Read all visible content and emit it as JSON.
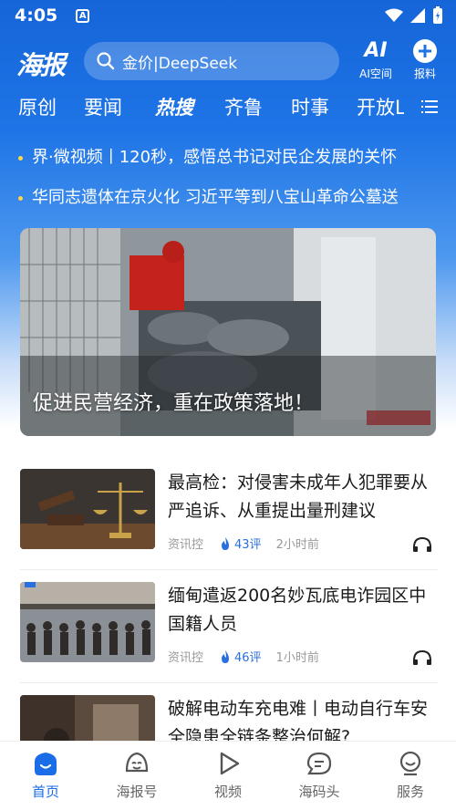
{
  "status": {
    "time": "4:05",
    "a_badge": "A"
  },
  "header": {
    "logo": "海报",
    "search_text": "金价|DeepSeek",
    "ai_label": "AI空间",
    "report_label": "报料",
    "ai_glyph": "AI"
  },
  "tabs": [
    "原创",
    "要闻",
    "热搜",
    "齐鲁",
    "时事",
    "开放L"
  ],
  "ticker": [
    "界·微视频丨120秒，感悟总书记对民企发展的关怀",
    "华同志遗体在京火化 习近平等到八宝山革命公墓送"
  ],
  "hero": {
    "caption": "促进民营经济，重在政策落地！"
  },
  "news": [
    {
      "title": "最高检：对侵害未成年人犯罪要从严追诉、从重提出量刑建议",
      "source": "资讯控",
      "comments": "43评",
      "time": "2小时前"
    },
    {
      "title": "缅甸遣返200名妙瓦底电诈园区中国籍人员",
      "source": "资讯控",
      "comments": "46评",
      "time": "1小时前"
    },
    {
      "title": "破解电动车充电难丨电动自行车安全隐患全链条整治何解?",
      "source": "",
      "comments": "",
      "time": ""
    }
  ],
  "nav": [
    {
      "label": "首页",
      "icon": "home-icon"
    },
    {
      "label": "海报号",
      "icon": "face-icon"
    },
    {
      "label": "视频",
      "icon": "play-icon"
    },
    {
      "label": "海码头",
      "icon": "chat-icon"
    },
    {
      "label": "服务",
      "icon": "service-icon"
    }
  ],
  "colors": {
    "brand": "#1a6de6",
    "accent": "#f8c24a",
    "comment": "#2a6fe0"
  }
}
